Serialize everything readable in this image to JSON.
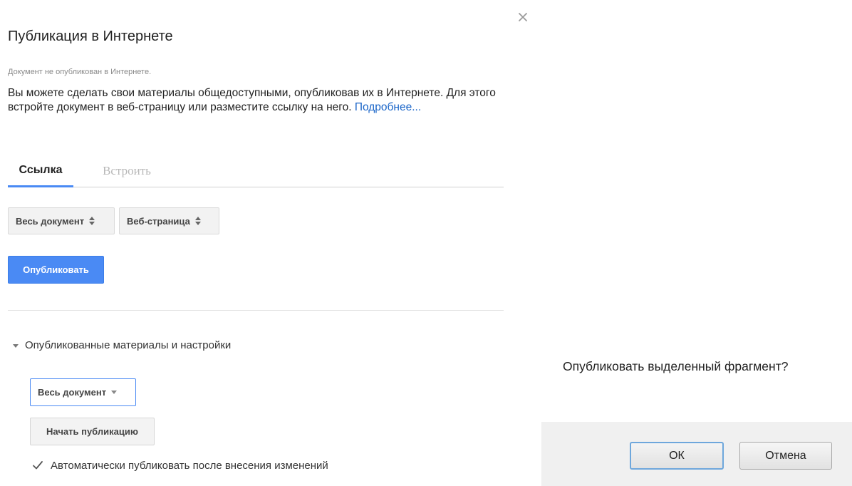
{
  "publish_dialog": {
    "title": "Публикация в Интернете",
    "close_icon": "close-icon",
    "status": "Документ не опубликован в Интернете.",
    "description": "Вы можете сделать свои материалы общедоступными, опубликовав их в Интернете. Для этого встройте документ в веб-страницу или разместите ссылку на него.",
    "learn_more": "Подробнее...",
    "tabs": [
      {
        "label": "Ссылка",
        "active": true
      },
      {
        "label": "Встроить",
        "active": false
      }
    ],
    "scope_select": {
      "value": "Весь документ",
      "icon": "updown-icon"
    },
    "format_select": {
      "value": "Веб-страница",
      "icon": "updown-icon"
    },
    "publish_button": "Опубликовать",
    "published_section": {
      "title": "Опубликованные материалы и настройки",
      "expanded": true,
      "scope_select": {
        "value": "Весь документ"
      },
      "start_button": "Начать публикацию",
      "auto_publish": {
        "label": "Автоматически публиковать после внесения изменений",
        "checked": true
      }
    },
    "colors": {
      "accent": "#4a8af4",
      "link": "#1a65c8",
      "muted_text": "#8a8a8a"
    }
  },
  "confirm_dialog": {
    "message": "Опубликовать выделенный фрагмент?",
    "ok_button": "ОК",
    "cancel_button": "Отмена"
  }
}
